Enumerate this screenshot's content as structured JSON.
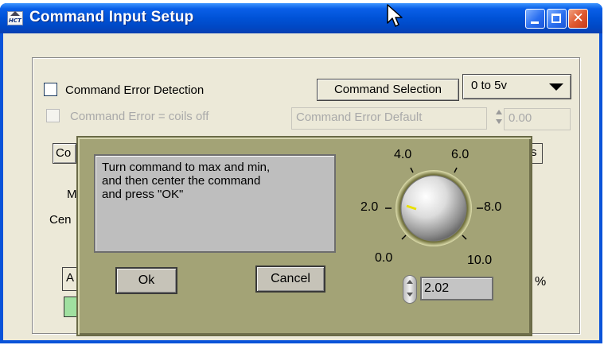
{
  "window": {
    "title": "Command Input Setup",
    "app_icon_text": "HCT",
    "close_glyph": "✕"
  },
  "form": {
    "command_error_detection_label": "Command Error Detection",
    "command_error_detection_checked": false,
    "command_error_coils_off_label": "Command Error = coils off",
    "command_error_coils_off_checked": false,
    "command_selection_button": "Command  Selection",
    "command_selection_value": "0 to 5v",
    "command_error_default_label": "Command Error Default",
    "command_error_default_value": "0.00",
    "obscured_partial_texts": [
      "Co",
      "s",
      "M",
      "Cen",
      "A"
    ],
    "percent_symbol": "%"
  },
  "dialog": {
    "message": "Turn command to max and min,\nand then center the command\nand press \"OK\"",
    "ok_label": "Ok",
    "cancel_label": "Cancel",
    "knob": {
      "scale_labels": [
        "0.0",
        "2.0",
        "4.0",
        "6.0",
        "8.0",
        "10.0"
      ],
      "value": "2.02",
      "min": 0,
      "max": 10,
      "indicator_color": "#e8e000"
    }
  },
  "colors": {
    "title_bar": "#0052d6",
    "client_bg": "#ece9d8",
    "dialog_bg": "#a3a376",
    "close_btn": "#e05a30"
  }
}
